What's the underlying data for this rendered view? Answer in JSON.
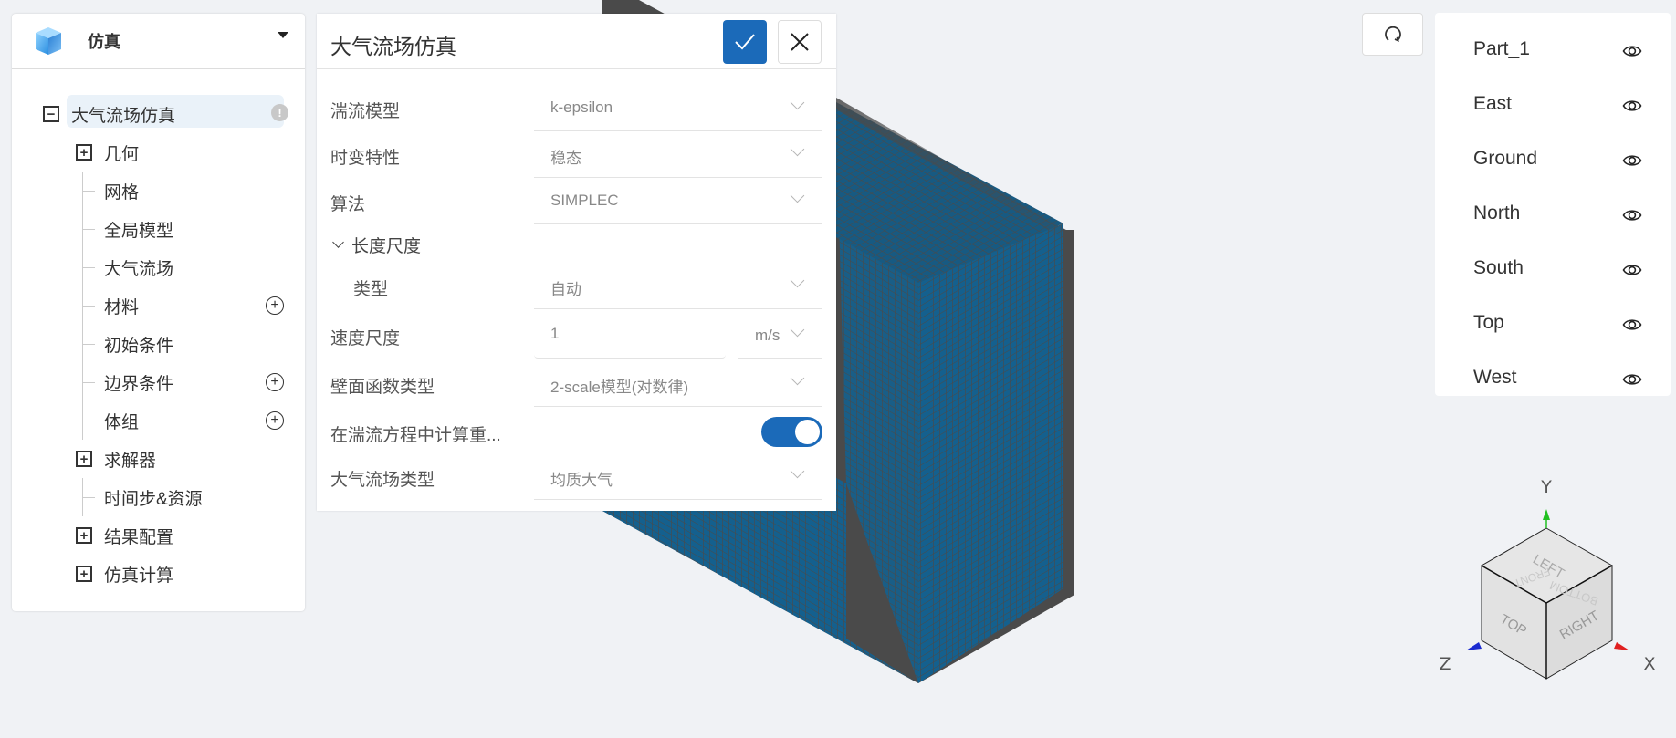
{
  "sidebar": {
    "title": "仿真",
    "tree": {
      "root": {
        "label": "大气流场仿真",
        "expanded": true,
        "badge": "!"
      },
      "items": [
        {
          "label": "几何",
          "type": "expandable",
          "expanded": false
        },
        {
          "label": "网格",
          "type": "leaf"
        },
        {
          "label": "全局模型",
          "type": "leaf"
        },
        {
          "label": "大气流场",
          "type": "leaf"
        },
        {
          "label": "材料",
          "type": "leaf",
          "addable": true
        },
        {
          "label": "初始条件",
          "type": "leaf"
        },
        {
          "label": "边界条件",
          "type": "leaf",
          "addable": true
        },
        {
          "label": "体组",
          "type": "leaf",
          "addable": true
        },
        {
          "label": "求解器",
          "type": "expandable",
          "expanded": false
        },
        {
          "label": "时间步&资源",
          "type": "leaf"
        },
        {
          "label": "结果配置",
          "type": "expandable",
          "expanded": false
        },
        {
          "label": "仿真计算",
          "type": "expandable",
          "expanded": false
        }
      ],
      "expand_symbol": "+",
      "collapse_symbol": "−",
      "add_symbol": "+"
    }
  },
  "panel": {
    "title": "大气流场仿真",
    "confirm_icon": "check-icon",
    "close_icon": "close-icon",
    "fields": {
      "turbulence_model": {
        "label": "湍流模型",
        "value": "k-epsilon"
      },
      "time_dependence": {
        "label": "时变特性",
        "value": "稳态"
      },
      "algorithm": {
        "label": "算法",
        "value": "SIMPLEC"
      },
      "length_scale_section": {
        "label": "长度尺度",
        "expanded": true
      },
      "length_scale_type": {
        "label": "类型",
        "value": "自动"
      },
      "velocity_scale": {
        "label": "速度尺度",
        "value": "1",
        "unit": "m/s"
      },
      "wall_function": {
        "label": "壁面函数类型",
        "value": "2-scale模型(对数律)"
      },
      "gravity_in_turbulence": {
        "label": "在湍流方程中计算重...",
        "enabled": true
      },
      "atmosphere_type": {
        "label": "大气流场类型",
        "value": "均质大气"
      }
    }
  },
  "toolbar": {
    "refresh_icon": "refresh-icon"
  },
  "parts": {
    "items": [
      {
        "name": "Part_1",
        "visible": true
      },
      {
        "name": "East",
        "visible": true
      },
      {
        "name": "Ground",
        "visible": true
      },
      {
        "name": "North",
        "visible": true
      },
      {
        "name": "South",
        "visible": true
      },
      {
        "name": "Top",
        "visible": true
      },
      {
        "name": "West",
        "visible": true
      }
    ]
  },
  "gizmo": {
    "axes": {
      "x": "X",
      "y": "Y",
      "z": "Z"
    },
    "faces": {
      "top_face": "LEFT",
      "left_face": "TOP",
      "right_face": "RIGHT",
      "ghost_1": "FRONT",
      "ghost_2": "BOTTOM"
    },
    "colors": {
      "x": "#e02020",
      "y": "#20c020",
      "z": "#1a2ad0"
    }
  },
  "colors": {
    "accent": "#1b6ab9",
    "mesh_cell": "#14608e",
    "mesh_line": "#4a4a4a",
    "background": "#f0f2f5"
  }
}
